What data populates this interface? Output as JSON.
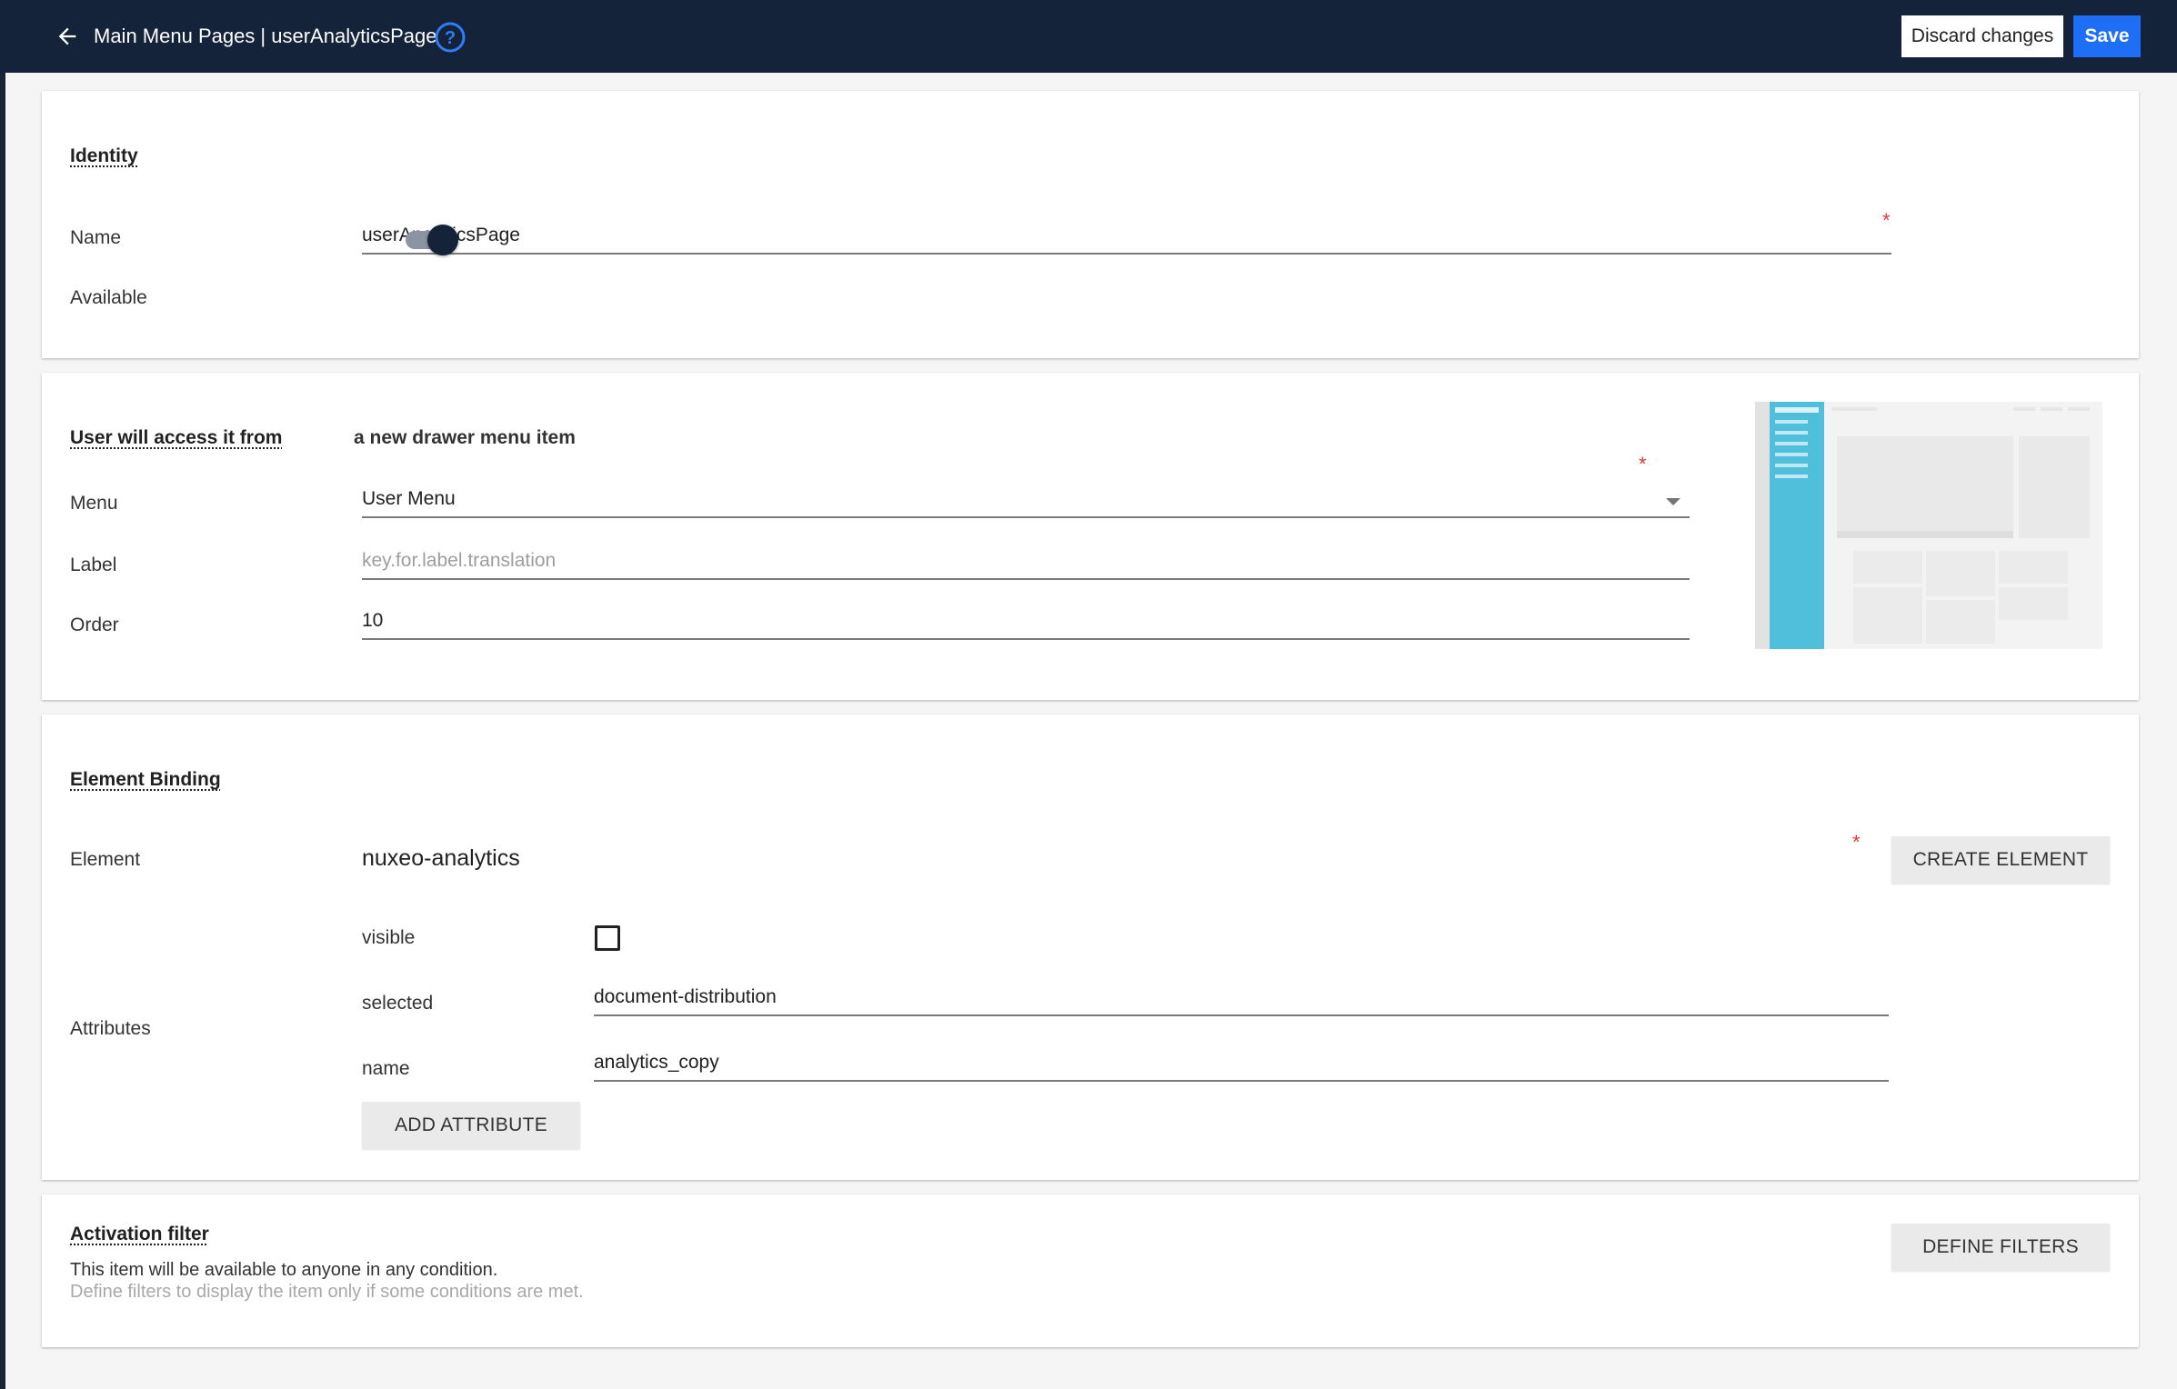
{
  "header": {
    "title": "Main Menu Pages |  userAnalyticsPage",
    "discard_label": "Discard changes",
    "save_label": "Save",
    "background": "#14223a",
    "save_color": "#1e6ff5"
  },
  "identity": {
    "section_title": "Identity",
    "name_label": "Name",
    "name_value": "userAnalyticsPage",
    "available_label": "Available",
    "available": true
  },
  "access": {
    "section_title": "User will access it from",
    "access_value": "a new drawer menu item",
    "menu_label": "Menu",
    "menu_value": "User Menu",
    "label_label": "Label",
    "label_placeholder": "key.for.label.translation",
    "order_label": "Order",
    "order_value": "10",
    "preview_accent": "#4fbfdc"
  },
  "binding": {
    "section_title": "Element Binding",
    "element_label": "Element",
    "element_value": "nuxeo-analytics",
    "create_element_label": "CREATE ELEMENT",
    "attributes_label": "Attributes",
    "attributes": [
      {
        "name": "visible",
        "type": "checkbox",
        "checked": false
      },
      {
        "name": "selected",
        "type": "text",
        "value": "document-distribution"
      },
      {
        "name": "name",
        "type": "text",
        "value": "analytics_copy"
      }
    ],
    "add_attribute_label": "ADD ATTRIBUTE"
  },
  "activation": {
    "section_title": "Activation filter",
    "line1": "This item will be available to anyone in any condition.",
    "line2": "Define filters to display the item only if some conditions are met.",
    "define_filters_label": "DEFINE FILTERS"
  }
}
